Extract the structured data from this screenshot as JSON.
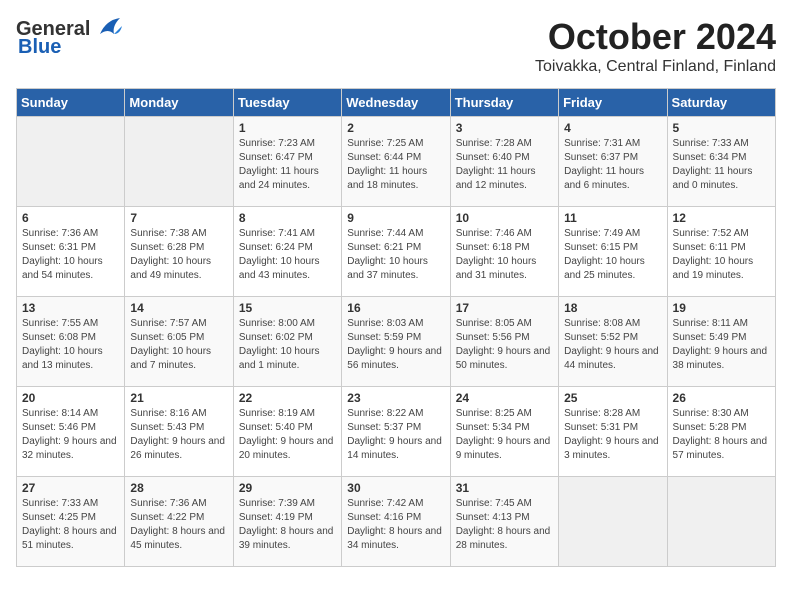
{
  "logo": {
    "general": "General",
    "blue": "Blue"
  },
  "title": "October 2024",
  "location": "Toivakka, Central Finland, Finland",
  "headers": [
    "Sunday",
    "Monday",
    "Tuesday",
    "Wednesday",
    "Thursday",
    "Friday",
    "Saturday"
  ],
  "weeks": [
    [
      {
        "day": "",
        "info": ""
      },
      {
        "day": "",
        "info": ""
      },
      {
        "day": "1",
        "sunrise": "7:23 AM",
        "sunset": "6:47 PM",
        "daylight": "11 hours and 24 minutes."
      },
      {
        "day": "2",
        "sunrise": "7:25 AM",
        "sunset": "6:44 PM",
        "daylight": "11 hours and 18 minutes."
      },
      {
        "day": "3",
        "sunrise": "7:28 AM",
        "sunset": "6:40 PM",
        "daylight": "11 hours and 12 minutes."
      },
      {
        "day": "4",
        "sunrise": "7:31 AM",
        "sunset": "6:37 PM",
        "daylight": "11 hours and 6 minutes."
      },
      {
        "day": "5",
        "sunrise": "7:33 AM",
        "sunset": "6:34 PM",
        "daylight": "11 hours and 0 minutes."
      }
    ],
    [
      {
        "day": "6",
        "sunrise": "7:36 AM",
        "sunset": "6:31 PM",
        "daylight": "10 hours and 54 minutes."
      },
      {
        "day": "7",
        "sunrise": "7:38 AM",
        "sunset": "6:28 PM",
        "daylight": "10 hours and 49 minutes."
      },
      {
        "day": "8",
        "sunrise": "7:41 AM",
        "sunset": "6:24 PM",
        "daylight": "10 hours and 43 minutes."
      },
      {
        "day": "9",
        "sunrise": "7:44 AM",
        "sunset": "6:21 PM",
        "daylight": "10 hours and 37 minutes."
      },
      {
        "day": "10",
        "sunrise": "7:46 AM",
        "sunset": "6:18 PM",
        "daylight": "10 hours and 31 minutes."
      },
      {
        "day": "11",
        "sunrise": "7:49 AM",
        "sunset": "6:15 PM",
        "daylight": "10 hours and 25 minutes."
      },
      {
        "day": "12",
        "sunrise": "7:52 AM",
        "sunset": "6:11 PM",
        "daylight": "10 hours and 19 minutes."
      }
    ],
    [
      {
        "day": "13",
        "sunrise": "7:55 AM",
        "sunset": "6:08 PM",
        "daylight": "10 hours and 13 minutes."
      },
      {
        "day": "14",
        "sunrise": "7:57 AM",
        "sunset": "6:05 PM",
        "daylight": "10 hours and 7 minutes."
      },
      {
        "day": "15",
        "sunrise": "8:00 AM",
        "sunset": "6:02 PM",
        "daylight": "10 hours and 1 minute."
      },
      {
        "day": "16",
        "sunrise": "8:03 AM",
        "sunset": "5:59 PM",
        "daylight": "9 hours and 56 minutes."
      },
      {
        "day": "17",
        "sunrise": "8:05 AM",
        "sunset": "5:56 PM",
        "daylight": "9 hours and 50 minutes."
      },
      {
        "day": "18",
        "sunrise": "8:08 AM",
        "sunset": "5:52 PM",
        "daylight": "9 hours and 44 minutes."
      },
      {
        "day": "19",
        "sunrise": "8:11 AM",
        "sunset": "5:49 PM",
        "daylight": "9 hours and 38 minutes."
      }
    ],
    [
      {
        "day": "20",
        "sunrise": "8:14 AM",
        "sunset": "5:46 PM",
        "daylight": "9 hours and 32 minutes."
      },
      {
        "day": "21",
        "sunrise": "8:16 AM",
        "sunset": "5:43 PM",
        "daylight": "9 hours and 26 minutes."
      },
      {
        "day": "22",
        "sunrise": "8:19 AM",
        "sunset": "5:40 PM",
        "daylight": "9 hours and 20 minutes."
      },
      {
        "day": "23",
        "sunrise": "8:22 AM",
        "sunset": "5:37 PM",
        "daylight": "9 hours and 14 minutes."
      },
      {
        "day": "24",
        "sunrise": "8:25 AM",
        "sunset": "5:34 PM",
        "daylight": "9 hours and 9 minutes."
      },
      {
        "day": "25",
        "sunrise": "8:28 AM",
        "sunset": "5:31 PM",
        "daylight": "9 hours and 3 minutes."
      },
      {
        "day": "26",
        "sunrise": "8:30 AM",
        "sunset": "5:28 PM",
        "daylight": "8 hours and 57 minutes."
      }
    ],
    [
      {
        "day": "27",
        "sunrise": "7:33 AM",
        "sunset": "4:25 PM",
        "daylight": "8 hours and 51 minutes."
      },
      {
        "day": "28",
        "sunrise": "7:36 AM",
        "sunset": "4:22 PM",
        "daylight": "8 hours and 45 minutes."
      },
      {
        "day": "29",
        "sunrise": "7:39 AM",
        "sunset": "4:19 PM",
        "daylight": "8 hours and 39 minutes."
      },
      {
        "day": "30",
        "sunrise": "7:42 AM",
        "sunset": "4:16 PM",
        "daylight": "8 hours and 34 minutes."
      },
      {
        "day": "31",
        "sunrise": "7:45 AM",
        "sunset": "4:13 PM",
        "daylight": "8 hours and 28 minutes."
      },
      {
        "day": "",
        "info": ""
      },
      {
        "day": "",
        "info": ""
      }
    ]
  ],
  "labels": {
    "sunrise": "Sunrise:",
    "sunset": "Sunset:",
    "daylight": "Daylight:"
  }
}
